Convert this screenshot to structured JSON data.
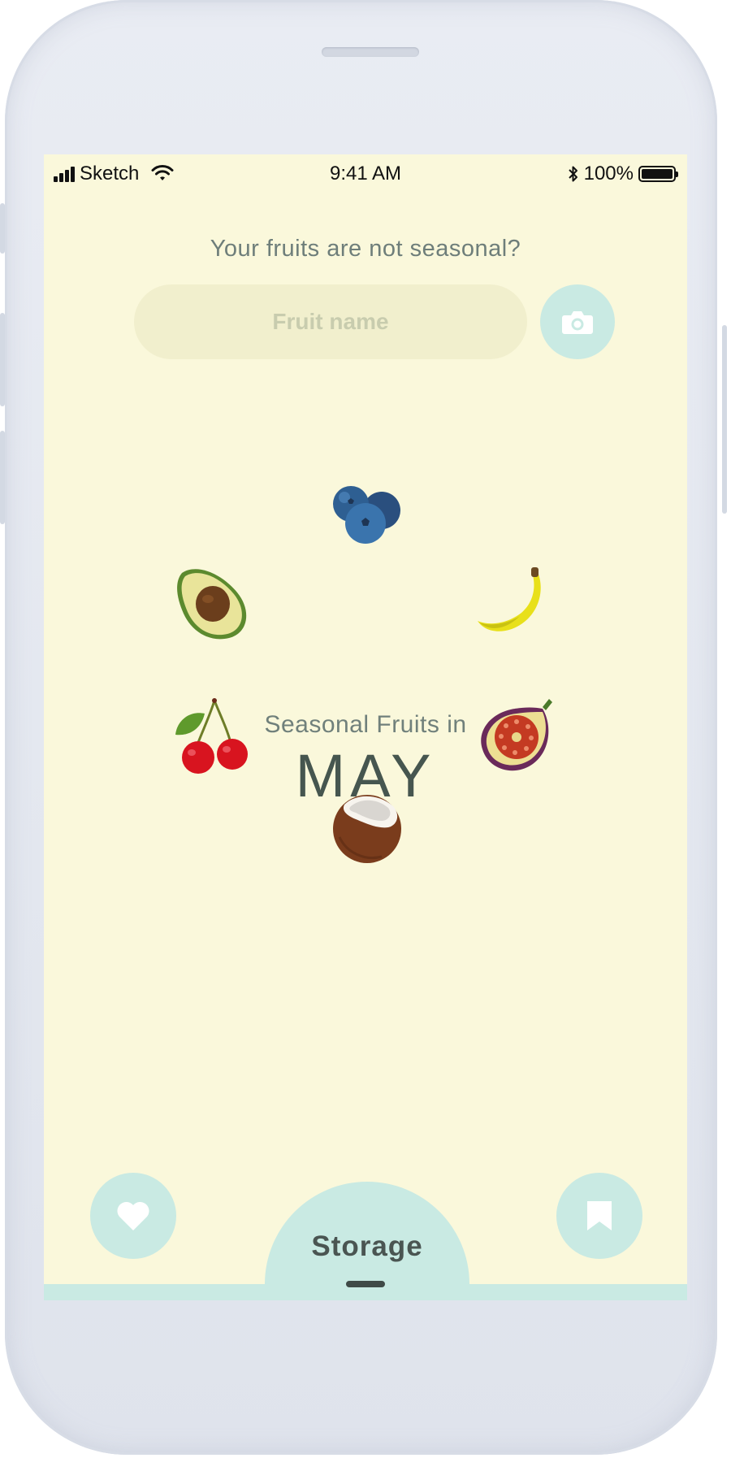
{
  "status_bar": {
    "carrier": "Sketch",
    "time": "9:41 AM",
    "battery_percent": "100%"
  },
  "search": {
    "prompt": "Your fruits are not seasonal?",
    "placeholder": "Fruit name",
    "camera_icon": "camera-icon"
  },
  "season": {
    "subtitle": "Seasonal Fruits in",
    "month": "MAY",
    "fruits": [
      "blueberries",
      "banana",
      "fig",
      "coconut",
      "cherries",
      "avocado"
    ]
  },
  "bottom_nav": {
    "favorites_icon": "heart-icon",
    "storage_label": "Storage",
    "bookmark_icon": "bookmark-icon"
  },
  "colors": {
    "screen_background": "#faf8db",
    "accent_mint": "#c9eae3",
    "text_dark": "#46564f"
  }
}
